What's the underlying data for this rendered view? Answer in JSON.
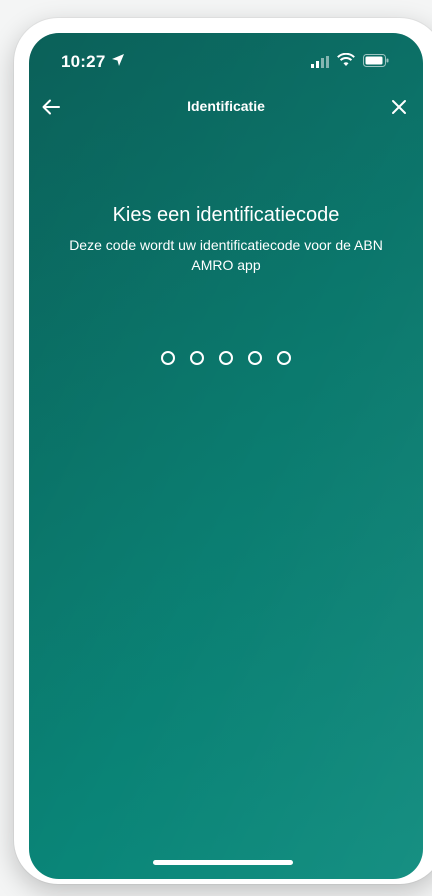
{
  "status_bar": {
    "time": "10:27",
    "icons": [
      "location-arrow-icon",
      "cellular-signal-icon",
      "wifi-icon",
      "battery-icon"
    ]
  },
  "nav": {
    "title": "Identificatie",
    "back_icon": "arrow-left-icon",
    "close_icon": "close-icon"
  },
  "main": {
    "heading": "Kies een identificatiecode",
    "subtitle": "Deze code wordt uw identificatiecode voor de ABN AMRO app",
    "pin_length": 5,
    "pin_filled": 0
  },
  "colors": {
    "background_start": "#0c6b63",
    "background_end": "#0a8a7c",
    "foreground": "#ffffff"
  }
}
